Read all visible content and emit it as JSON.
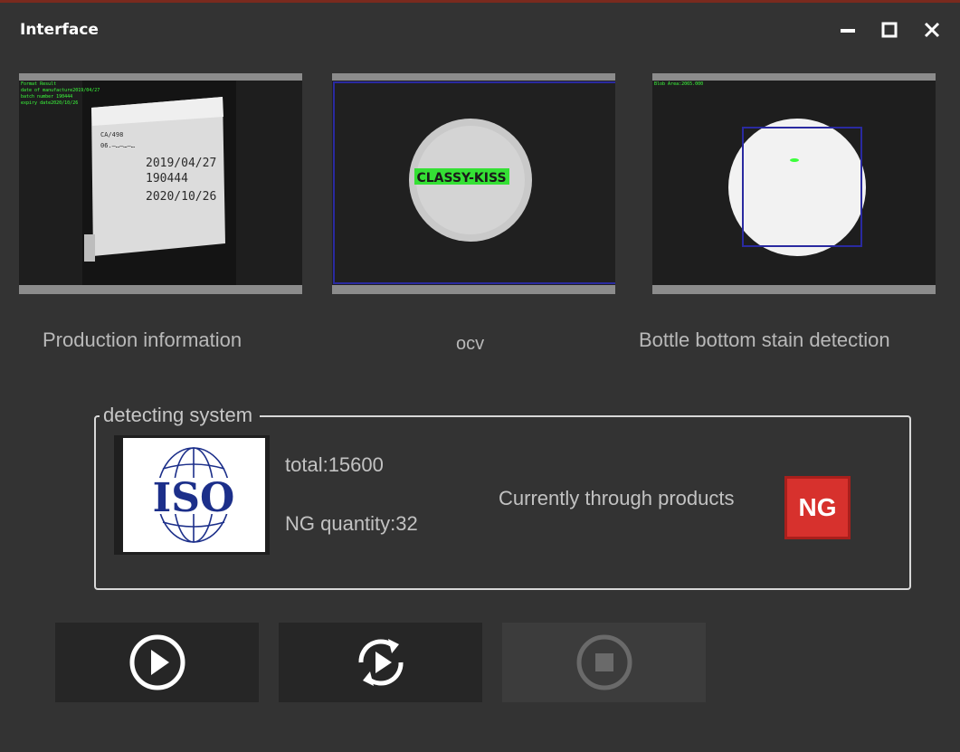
{
  "window": {
    "title": "Interface",
    "controls": [
      "minimize-icon",
      "maximize-icon",
      "close-icon"
    ]
  },
  "colors": {
    "background": "#333333",
    "accent_red": "#d7312d",
    "detection_green": "#3cff3c",
    "roi_blue": "#2a2aa0"
  },
  "panels": [
    {
      "caption": "Production information",
      "overlay_text": [
        "Format Result",
        "date of manufacture2019/04/27",
        "batch number 190444",
        "expiry date2020/10/26"
      ],
      "label_lines": [
        "2019/04/27",
        "190444",
        "2020/10/26"
      ]
    },
    {
      "caption": "ocv",
      "ocv_text": "CLASSY-KISS"
    },
    {
      "caption": "Bottle bottom stain detection",
      "overlay_text": "Blob Area:2065.000"
    }
  ],
  "detecting_system": {
    "legend": "detecting system",
    "logo_text": "ISO",
    "total_label": "total:15600",
    "ng_quantity_label": "NG quantity:32",
    "current_label": "Currently through products",
    "current_status": "NG"
  },
  "controls": [
    {
      "icon": "play-icon",
      "enabled": true
    },
    {
      "icon": "reload-play-icon",
      "enabled": true
    },
    {
      "icon": "stop-icon",
      "enabled": false
    }
  ]
}
